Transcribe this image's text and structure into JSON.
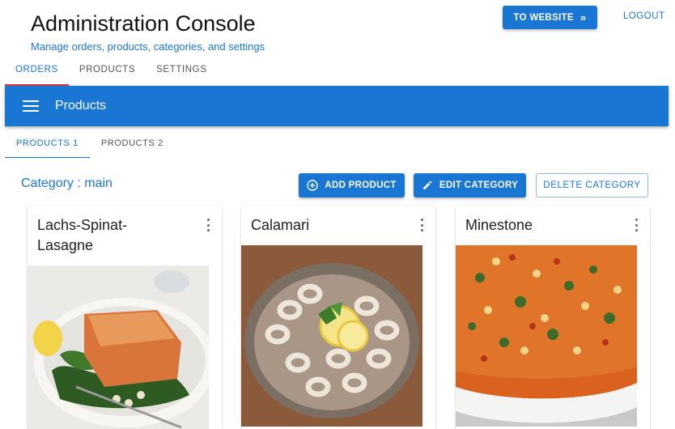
{
  "header": {
    "title": "Administration Console",
    "subtitle": "Manage orders, products, categories, and settings",
    "website_button": "TO WEBSITE",
    "logout": "LOGOUT"
  },
  "main_tabs": [
    {
      "label": "ORDERS",
      "active": true
    },
    {
      "label": "PRODUCTS",
      "active": false
    },
    {
      "label": "SETTINGS",
      "active": false
    }
  ],
  "appbar": {
    "title": "Products",
    "color": "#1976d2"
  },
  "sub_tabs": [
    {
      "label": "PRODUCTS 1",
      "active": true
    },
    {
      "label": "PRODUCTS 2",
      "active": false
    }
  ],
  "category": {
    "label": "Category : main"
  },
  "actions": {
    "add": "ADD PRODUCT",
    "edit": "EDIT CATEGORY",
    "delete": "DELETE CATEGORY"
  },
  "products": [
    {
      "name": "Lachs-Spinat-Lasagne",
      "image": "salmon-spinach-dish"
    },
    {
      "name": "Calamari",
      "image": "calamari-plate"
    },
    {
      "name": "Minestone",
      "image": "minestrone-soup"
    }
  ],
  "colors": {
    "primary": "#1976d2",
    "tab_indicator": "#e53935"
  }
}
